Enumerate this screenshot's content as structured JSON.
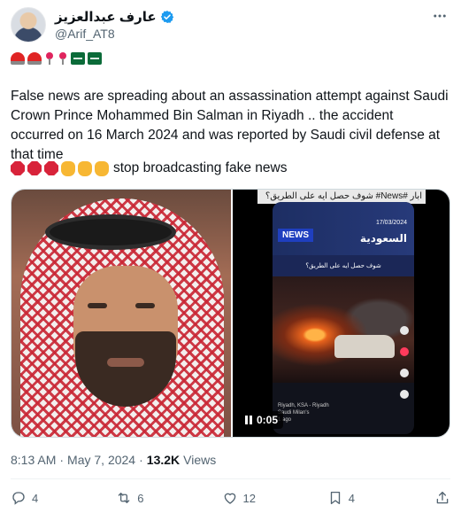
{
  "author": {
    "display_name": "عارف عبدالعزيز",
    "handle": "@Arif_AT8",
    "verified_icon": "verified-badge-icon"
  },
  "more_icon": "more-icon",
  "emoji_row": [
    "police-light",
    "police-light",
    "round-pushpin",
    "round-pushpin",
    "saudi-flag",
    "saudi-flag"
  ],
  "tweet": {
    "text": "False news are spreading about an assassination attempt against Saudi Crown Prince Mohammed Bin Salman in Riyadh .. the accident occurred on 16 March 2024 and was reported by Saudi civil defense at that time",
    "stop_line": "stop broadcasting fake news"
  },
  "media": {
    "video_caption": "ابار #News# شوف حصل ايه على الطريق؟",
    "news_logo": "NEWS",
    "news_date": "17/03/2024",
    "news_country": "السعودية",
    "news_subtitle": "شوف حصل ايه على الطريق؟",
    "phone_meta_1": "Riyadh, KSA - Riyadh",
    "phone_meta_2": "Saudi Milan's",
    "phone_meta_3": "1 ago",
    "video_time": "0:05"
  },
  "meta": {
    "time": "8:13 AM",
    "date": "May 7, 2024",
    "separator": "·",
    "views_count": "13.2K",
    "views_label": "Views"
  },
  "actions": {
    "replies": "4",
    "reposts": "6",
    "likes": "12",
    "bookmarks": "4"
  },
  "colors": {
    "text_primary": "#0f1419",
    "text_secondary": "#536471",
    "verified_blue": "#1d9bf0",
    "border": "#cfd9de"
  }
}
